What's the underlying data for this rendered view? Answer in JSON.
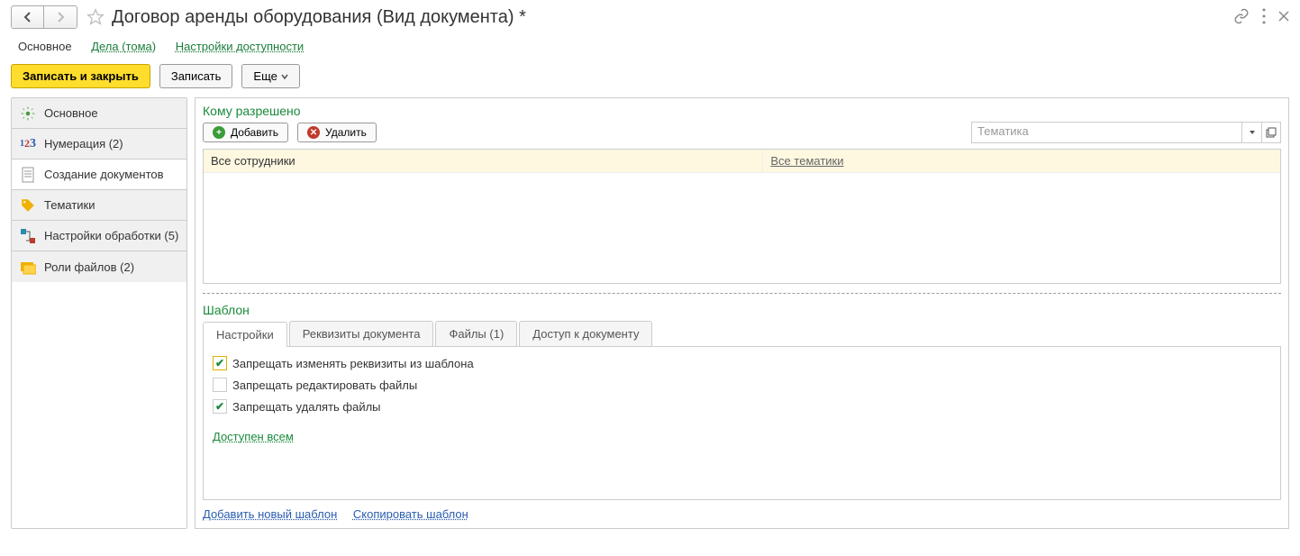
{
  "header": {
    "title": "Договор аренды оборудования (Вид документа) *"
  },
  "topTabs": {
    "main": "Основное",
    "cases": "Дела (тома)",
    "access": "Настройки доступности"
  },
  "toolbar": {
    "save_close": "Записать и закрыть",
    "save": "Записать",
    "more": "Еще"
  },
  "sidebar": {
    "items": [
      {
        "label": "Основное"
      },
      {
        "label": "Нумерация (2)"
      },
      {
        "label": "Создание документов"
      },
      {
        "label": "Тематики"
      },
      {
        "label": "Настройки обработки (5)"
      },
      {
        "label": "Роли файлов (2)"
      }
    ]
  },
  "section1": {
    "title": "Кому разрешено",
    "add": "Добавить",
    "del": "Удалить",
    "combo_placeholder": "Тематика",
    "grid_h1": "Все сотрудники",
    "grid_h2": "Все тематики"
  },
  "section2": {
    "title": "Шаблон",
    "tabs": {
      "settings": "Настройки",
      "props": "Реквизиты документа",
      "files": "Файлы (1)",
      "access": "Доступ к документу"
    },
    "chk1": "Запрещать изменять реквизиты из шаблона",
    "chk2": "Запрещать редактировать файлы",
    "chk3": "Запрещать удалять файлы",
    "avail": "Доступен всем"
  },
  "bottom": {
    "add_tmpl": "Добавить новый шаблон",
    "copy_tmpl": "Скопировать шаблон"
  }
}
